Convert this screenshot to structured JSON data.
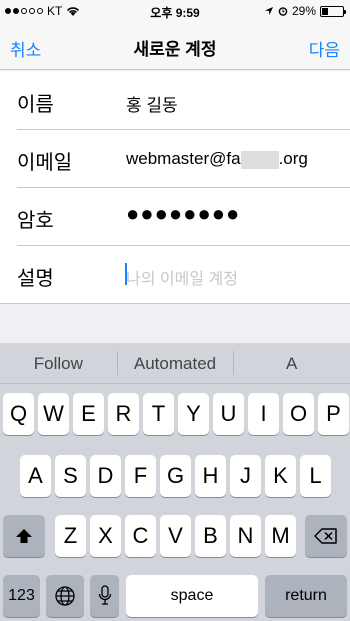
{
  "status_bar": {
    "carrier": "KT",
    "time": "오후 9:59",
    "battery": "29%",
    "battery_level": 0.29,
    "signal_filled": 2,
    "signal_total": 5
  },
  "nav": {
    "cancel_label": "취소",
    "title": "새로운 계정",
    "next_label": "다음"
  },
  "form": {
    "name_label": "이름",
    "name_value": "홍 길동",
    "email_label": "이메일",
    "email_prefix": "webmaster@fa",
    "email_suffix": ".org",
    "password_label": "암호",
    "password_value": "●●●●●●●●",
    "description_label": "설명",
    "description_placeholder": "나의 이메일 계정"
  },
  "keyboard": {
    "suggestions": [
      "Follow",
      "Automated",
      "A"
    ],
    "row1": [
      "Q",
      "W",
      "E",
      "R",
      "T",
      "Y",
      "U",
      "I",
      "O",
      "P"
    ],
    "row2": [
      "A",
      "S",
      "D",
      "F",
      "G",
      "H",
      "J",
      "K",
      "L"
    ],
    "row3": [
      "Z",
      "X",
      "C",
      "V",
      "B",
      "N",
      "M"
    ],
    "numbers_label": "123",
    "space_label": "space",
    "return_label": "return",
    "shift_icon": "shift-icon",
    "delete_icon": "backspace-icon",
    "globe_icon": "globe-icon",
    "mic_icon": "microphone-icon"
  },
  "colors": {
    "accent": "#1a82fb"
  }
}
